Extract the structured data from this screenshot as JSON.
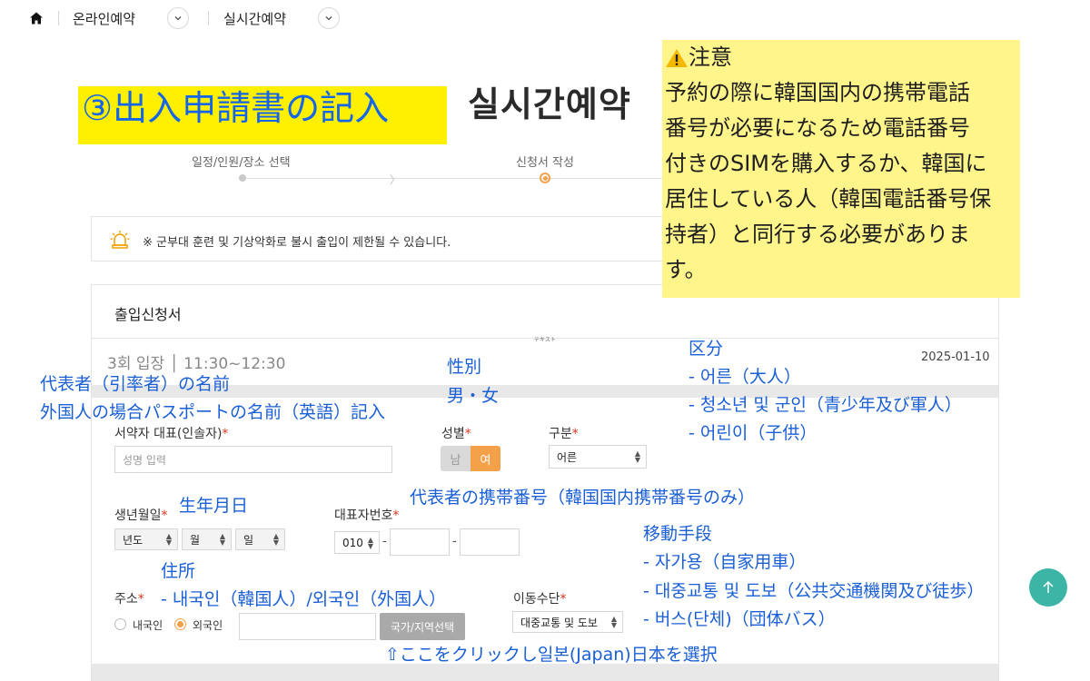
{
  "nav": {
    "item1": "온라인예약",
    "item2": "실시간예약"
  },
  "page_title": "실시간예약",
  "notes": {
    "title_note": "③出入申請書の記入",
    "caution_heading": "注意",
    "caution_lines": [
      "予約の際に韓国国内の携帯電話",
      "番号が必要になるため電話番号",
      "付きのSIMを購入するか、韓国に",
      "居住している人（韓国電話番号保",
      "持者）と同行する必要がありま",
      "す。"
    ]
  },
  "steps": [
    "일정/인원/장소 선택",
    "신청서 작성"
  ],
  "notice": "※ 군부대 훈련 및 기상악화로 불시 출입이 제한될 수 있습니다.",
  "form": {
    "title": "출입신청서",
    "tiny_text": "テキスト",
    "entry_time": "3회 입장 │ 11:30~12:30",
    "entry_date": "2025-01-10",
    "rep_label": "서약자 대표(인솔자)",
    "rep_placeholder": "성명 입력",
    "gender_label": "성별",
    "gender_male": "남",
    "gender_female": "여",
    "category_label": "구분",
    "category_value": "어른",
    "birth_label": "생년월일",
    "birth_year": "년도",
    "birth_month": "월",
    "birth_day": "일",
    "phone_label": "대표자번호",
    "phone_prefix": "010",
    "address_label": "주소",
    "address_domestic": "내국인",
    "address_foreign": "외국인",
    "region_button": "국가/지역선택",
    "transport_label": "이동수단",
    "transport_value": "대중교통 및 도보",
    "required_mark": "*",
    "dash": "-"
  },
  "annotations": {
    "rep_1": "代表者（引率者）の名前",
    "rep_2": "外国人の場合パスポートの名前（英語）記入",
    "gender_1": "性別",
    "gender_2": "男・女",
    "category_1": "区分",
    "category_2": "- 어른（大人）",
    "category_3": "- 청소년 및 군인（青少年及び軍人）",
    "category_4": "- 어린이（子供）",
    "birth": "生年月日",
    "phone": "代表者の携帯番号（韓国国内携帯番号のみ）",
    "transport_1": "移動手段",
    "transport_2": "- 자가용（自家用車）",
    "transport_3": "- 대중교통 및 도보（公共交通機関及び徒歩）",
    "transport_4": "- 버스(단체)（団体バス）",
    "address_1": "住所",
    "address_2": "- 내국인（韓国人）/외국인（外国人）",
    "region": "⇧ここをクリックし일본(Japan)日本を選択"
  },
  "colors": {
    "accent_orange": "#f5a14a",
    "annotation_blue": "#1a5fd6",
    "highlight_yellow": "#fff000",
    "note_yellow": "#fff58b",
    "top_button": "#3cb5a7"
  },
  "icons": [
    "home-icon",
    "chevron-down-icon",
    "alarm-light-icon",
    "warning-icon",
    "arrow-up-icon"
  ]
}
